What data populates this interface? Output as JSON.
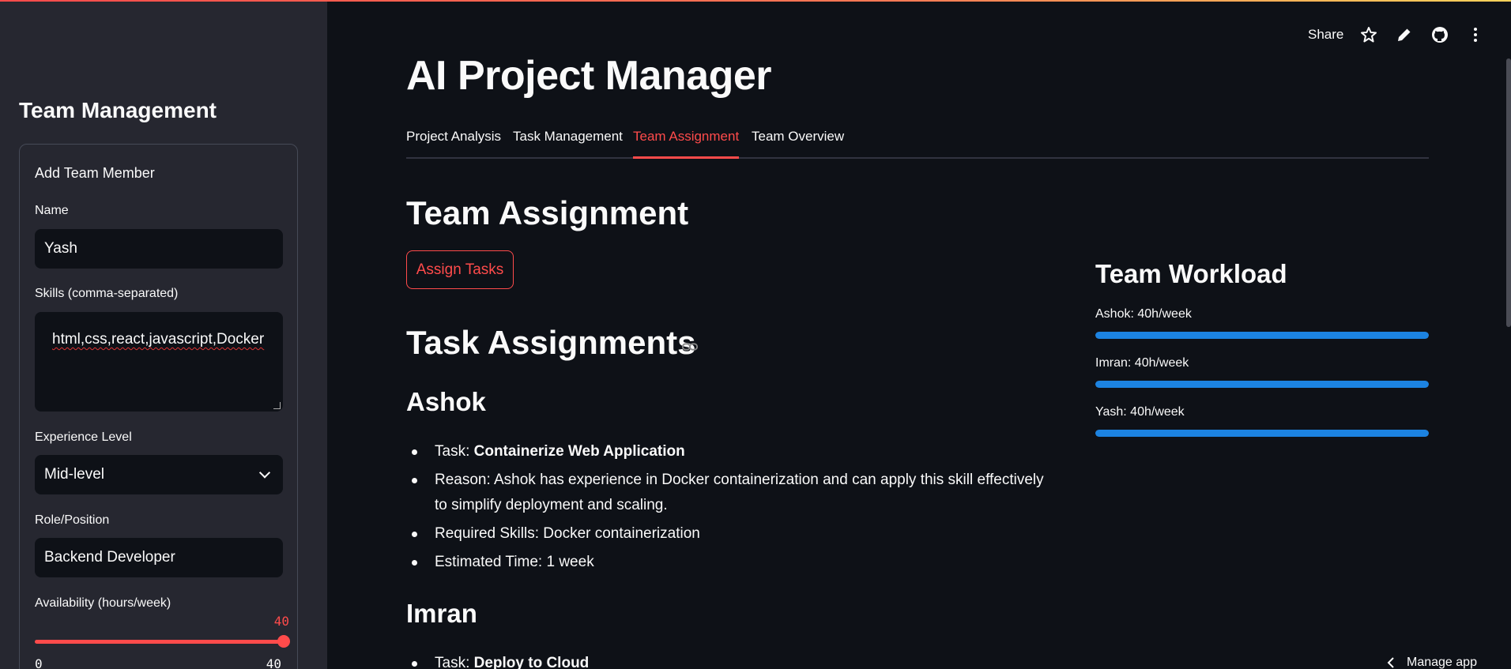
{
  "header": {
    "share_label": "Share",
    "icons": [
      "star-icon",
      "pencil-icon",
      "github-icon",
      "kebab-menu-icon"
    ]
  },
  "sidebar": {
    "title": "Team Management",
    "form": {
      "title": "Add Team Member",
      "name_label": "Name",
      "name_value": "Yash",
      "skills_label": "Skills (comma-separated)",
      "skills_value": "html,css,react,javascript,Docker",
      "experience_label": "Experience Level",
      "experience_value": "Mid-level",
      "role_label": "Role/Position",
      "role_value": "Backend Developer",
      "availability_label": "Availability (hours/week)",
      "availability_value": "40",
      "availability_min": "0",
      "availability_max": "40",
      "availability_fraction": 1.0
    }
  },
  "main": {
    "title": "AI Project Manager",
    "tabs": [
      {
        "label": "Project Analysis"
      },
      {
        "label": "Task Management"
      },
      {
        "label": "Team Assignment",
        "active": true
      },
      {
        "label": "Team Overview"
      }
    ],
    "section_title": "Team Assignment",
    "assign_button": "Assign Tasks",
    "assignments_title": "Task Assignments",
    "assignments": [
      {
        "member": "Ashok",
        "task_prefix": "Task: ",
        "task": "Containerize Web Application",
        "reason": "Reason: Ashok has experience in Docker containerization and can apply this skill effectively to simplify deployment and scaling.",
        "skills": "Required Skills: Docker containerization",
        "time": "Estimated Time: 1 week"
      },
      {
        "member": "Imran",
        "task_prefix": "Task: ",
        "task": "Deploy to Cloud"
      }
    ]
  },
  "workload": {
    "title": "Team Workload",
    "members": [
      {
        "label": "Ashok: 40h/week",
        "fraction": 1.0
      },
      {
        "label": "Imran: 40h/week",
        "fraction": 1.0
      },
      {
        "label": "Yash: 40h/week",
        "fraction": 1.0
      }
    ]
  },
  "footer": {
    "manage_app": "Manage app"
  },
  "colors": {
    "accent": "#ff4b4b",
    "progress": "#1c83e1",
    "background": "#0e1117",
    "sidebar": "#262730"
  }
}
